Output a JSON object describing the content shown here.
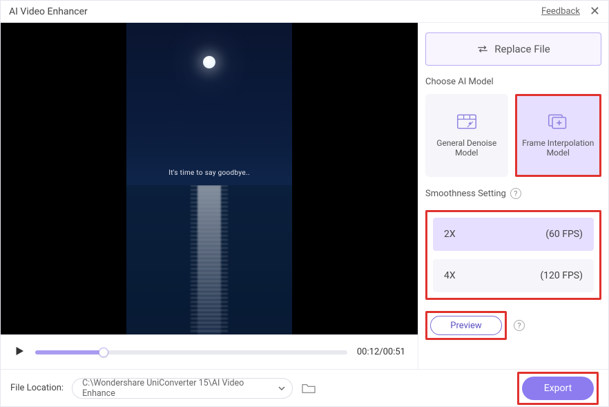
{
  "titlebar": {
    "title": "AI Video Enhancer",
    "feedback": "Feedback"
  },
  "preview": {
    "caption": "It's time to say goodbye..",
    "time_current": "00:12",
    "time_total": "00:51",
    "time_display": "00:12/00:51"
  },
  "right_panel": {
    "replace_label": "Replace File",
    "choose_model_label": "Choose AI Model",
    "models": [
      {
        "name": "General Denoise Model",
        "selected": false
      },
      {
        "name": "Frame Interpolation Model",
        "selected": true
      }
    ],
    "smoothness_label": "Smoothness Setting",
    "fps_options": [
      {
        "multiplier": "2X",
        "fps": "(60 FPS)",
        "selected": true
      },
      {
        "multiplier": "4X",
        "fps": "(120 FPS)",
        "selected": false
      }
    ],
    "preview_label": "Preview"
  },
  "footer": {
    "location_label": "File Location:",
    "path": "C:\\Wondershare UniConverter 15\\AI Video Enhance",
    "export_label": "Export"
  }
}
